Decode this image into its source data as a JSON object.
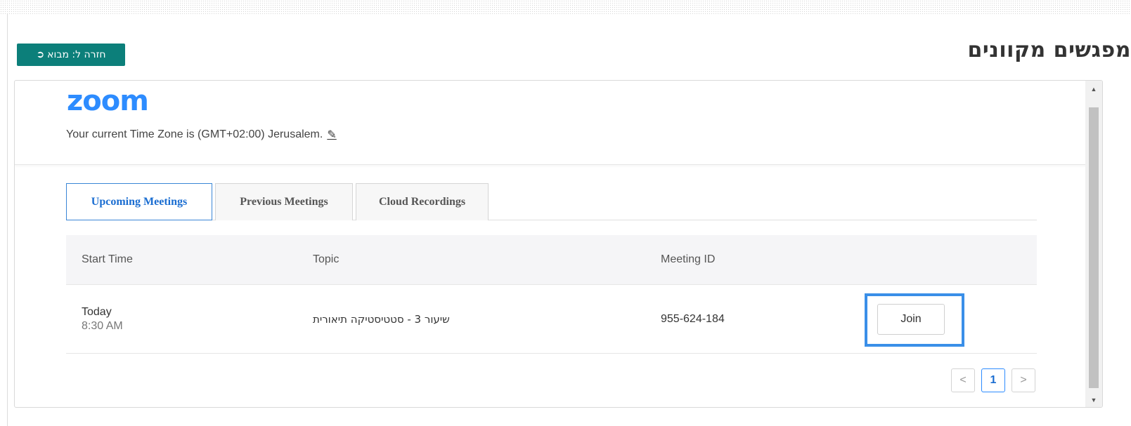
{
  "page": {
    "title": "מפגשים מקוונים",
    "back_button": "חזרה ל: מבוא",
    "back_icon": "sign-in-icon"
  },
  "zoom": {
    "logo": "zoom",
    "timezone_text": "Your current Time Zone is (GMT+02:00) Jerusalem.",
    "edit_icon": "pencil-icon"
  },
  "tabs": [
    {
      "label": "Upcoming Meetings",
      "active": true
    },
    {
      "label": "Previous Meetings",
      "active": false
    },
    {
      "label": "Cloud Recordings",
      "active": false
    }
  ],
  "table": {
    "headers": {
      "start_time": "Start Time",
      "topic": "Topic",
      "meeting_id": "Meeting ID"
    },
    "rows": [
      {
        "date": "Today",
        "time": "8:30 AM",
        "topic": "שיעור 3 - סטטיסטיקה תיאורית",
        "meeting_id": "955-624-184",
        "action": "Join"
      }
    ]
  },
  "pagination": {
    "prev": "<",
    "current": "1",
    "next": ">"
  },
  "colors": {
    "accent": "#2d8cff",
    "back_button_bg": "#0c7f7a",
    "highlight_border": "#3a8fe8"
  }
}
